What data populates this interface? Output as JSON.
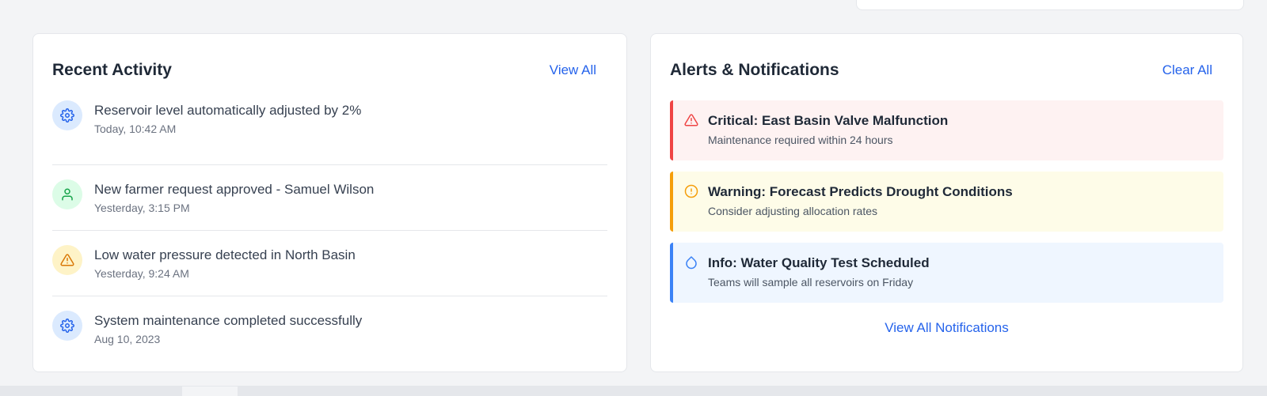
{
  "activity": {
    "title": "Recent Activity",
    "view_all_label": "View All",
    "items": [
      {
        "icon": "gear-icon",
        "color": "#2563eb",
        "title": "Reservoir level automatically adjusted by 2%",
        "time": "Today, 10:42 AM"
      },
      {
        "icon": "user-icon",
        "color": "#16a34a",
        "title": "New farmer request approved - Samuel Wilson",
        "time": "Yesterday, 3:15 PM"
      },
      {
        "icon": "warning-icon",
        "color": "#d97706",
        "title": "Low water pressure detected in North Basin",
        "time": "Yesterday, 9:24 AM"
      },
      {
        "icon": "gear-icon",
        "color": "#2563eb",
        "title": "System maintenance completed successfully",
        "time": "Aug 10, 2023"
      }
    ]
  },
  "alerts": {
    "title": "Alerts & Notifications",
    "clear_all_label": "Clear All",
    "view_all_label": "View All Notifications",
    "items": [
      {
        "severity": "critical",
        "icon": "warning-triangle-icon",
        "color": "#ef4444",
        "title": "Critical: East Basin Valve Malfunction",
        "description": "Maintenance required within 24 hours"
      },
      {
        "severity": "warning",
        "icon": "info-circle-icon",
        "color": "#f59e0b",
        "title": "Warning: Forecast Predicts Drought Conditions",
        "description": "Consider adjusting allocation rates"
      },
      {
        "severity": "info",
        "icon": "droplet-icon",
        "color": "#3b82f6",
        "title": "Info: Water Quality Test Scheduled",
        "description": "Teams will sample all reservoirs on Friday"
      }
    ]
  }
}
